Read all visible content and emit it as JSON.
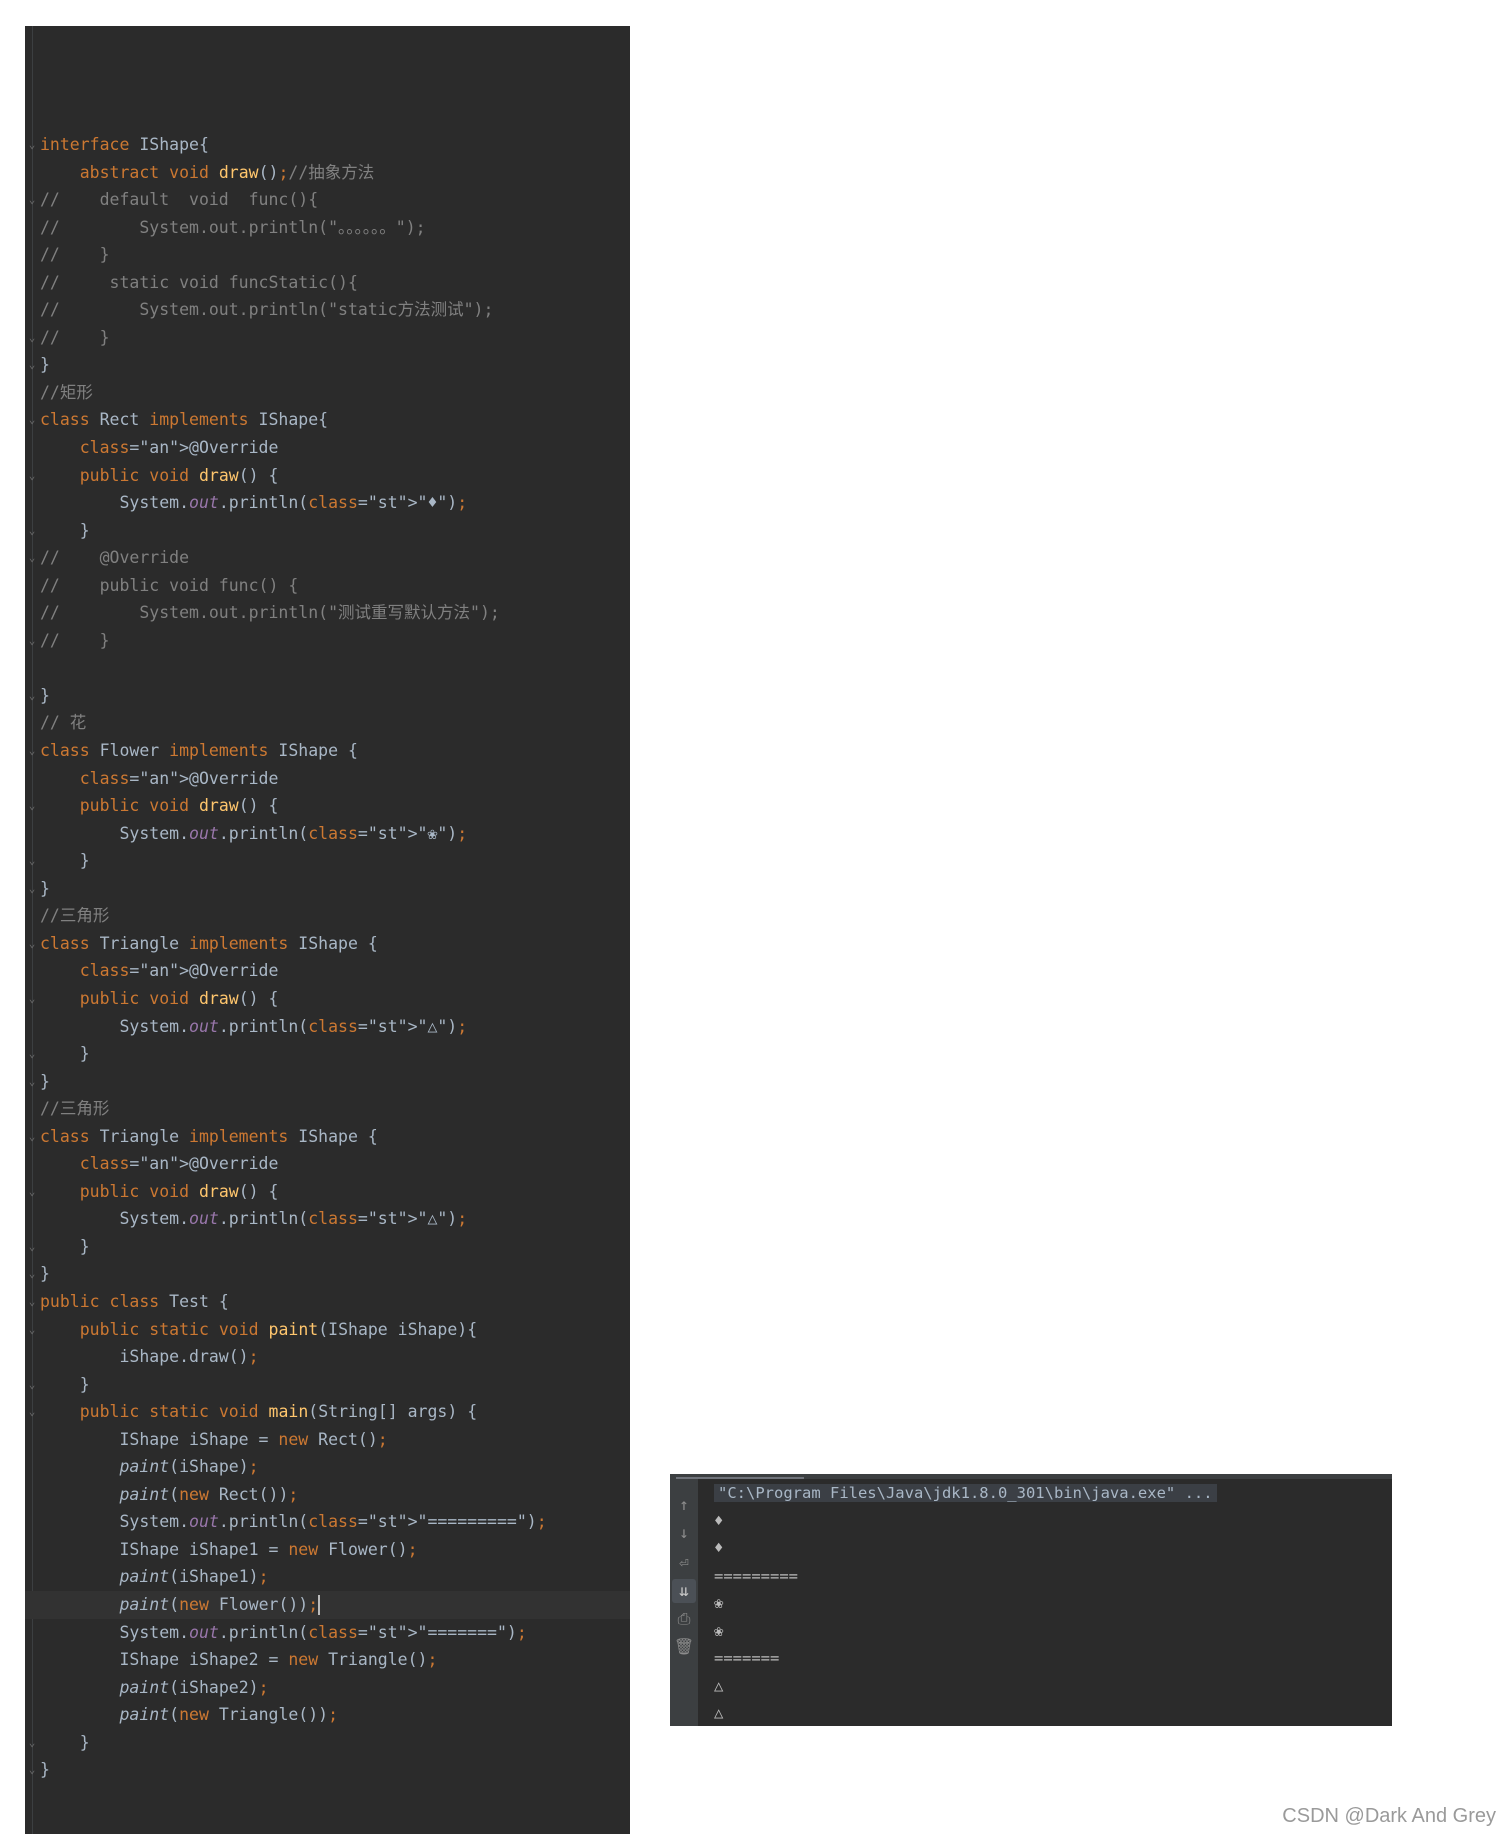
{
  "editor": {
    "lines": [
      "interface IShape{",
      "    abstract void draw();//抽象方法",
      "//    default  void  func(){",
      "//        System.out.println(\"。。。。。。\");",
      "//    }",
      "//     static void funcStatic(){",
      "//        System.out.println(\"static方法测试\");",
      "//    }",
      "}",
      "//矩形",
      "class Rect implements IShape{",
      "    @Override",
      "    public void draw() {",
      "        System.out.println(\"♦\");",
      "    }",
      "//    @Override",
      "//    public void func() {",
      "//        System.out.println(\"测试重写默认方法\");",
      "//    }",
      "",
      "}",
      "// 花",
      "class Flower implements IShape {",
      "    @Override",
      "    public void draw() {",
      "        System.out.println(\"❀\");",
      "    }",
      "}",
      "//三角形",
      "class Triangle implements IShape {",
      "    @Override",
      "    public void draw() {",
      "        System.out.println(\"△\");",
      "    }",
      "}",
      "//三角形",
      "class Triangle implements IShape {",
      "    @Override",
      "    public void draw() {",
      "        System.out.println(\"△\");",
      "    }",
      "}",
      "public class Test {",
      "    public static void paint(IShape iShape){",
      "        iShape.draw();",
      "    }",
      "    public static void main(String[] args) {",
      "        IShape iShape = new Rect();",
      "        paint(iShape);",
      "        paint(new Rect());",
      "        System.out.println(\"=========\");",
      "        IShape iShape1 = new Flower();",
      "        paint(iShape1);",
      "        paint(new Flower());",
      "        System.out.println(\"=======\");",
      "        IShape iShape2 = new Triangle();",
      "        paint(iShape2);",
      "        paint(new Triangle());",
      "    }",
      "}"
    ]
  },
  "console": {
    "command": "\"C:\\Program Files\\Java\\jdk1.8.0_301\\bin\\java.exe\" ...",
    "output": [
      "♦",
      "♦",
      "=========",
      "❀",
      "❀",
      "=======",
      "△",
      "△"
    ],
    "toolbar": [
      {
        "name": "up-arrow-icon",
        "glyph": "↑"
      },
      {
        "name": "down-arrow-icon",
        "glyph": "↓"
      },
      {
        "name": "soft-wrap-icon",
        "glyph": "⏎"
      },
      {
        "name": "scroll-to-end-icon",
        "glyph": "⇊"
      },
      {
        "name": "print-icon",
        "glyph": "⎙"
      },
      {
        "name": "trash-icon",
        "glyph": "🗑"
      }
    ]
  },
  "watermark": "CSDN @Dark And Grey"
}
